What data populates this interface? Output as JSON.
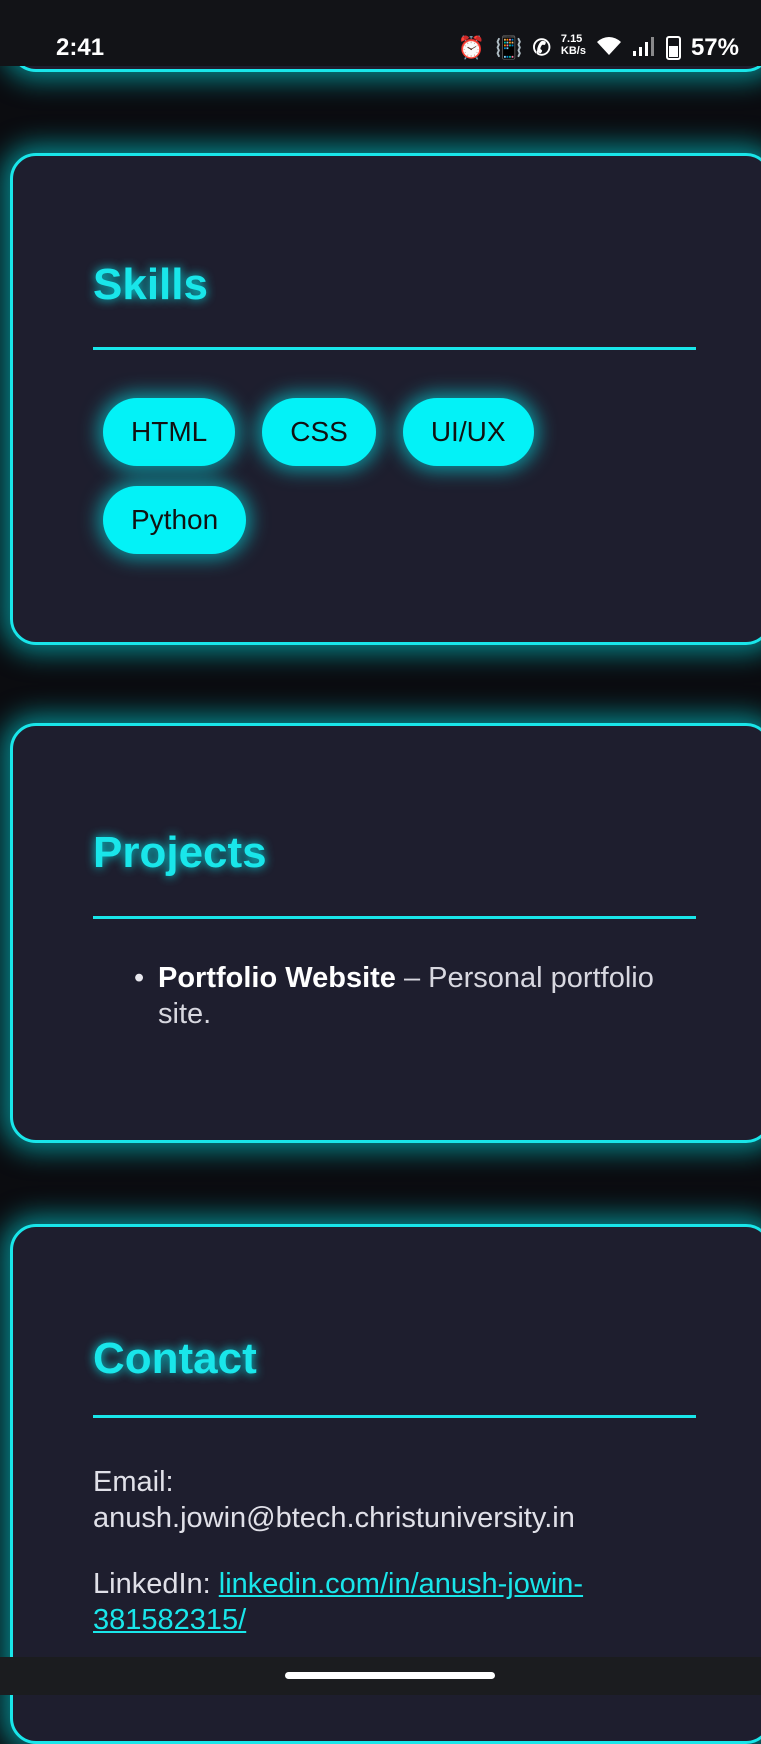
{
  "status_bar": {
    "time": "2:41",
    "speed_value": "7.15",
    "speed_unit": "KB/s",
    "battery": "57%",
    "icons": [
      "alarm-icon",
      "vibrate-icon",
      "call-icon",
      "wifi-icon",
      "signal-icon",
      "battery-icon"
    ]
  },
  "skills": {
    "title": "Skills",
    "items": [
      "HTML",
      "CSS",
      "UI/UX",
      "Python"
    ]
  },
  "projects": {
    "title": "Projects",
    "items": [
      {
        "name": "Portfolio Website",
        "description": " – Personal portfolio site."
      }
    ]
  },
  "contact": {
    "title": "Contact",
    "email_label": "Email:",
    "email": "anush.jowin@btech.christuniversity.in",
    "linkedin_label": "LinkedIn: ",
    "linkedin": "linkedin.com/in/anush-jowin-381582315/"
  },
  "colors": {
    "accent": "#19e6ea",
    "pill_bg": "#03f2f7",
    "card_bg": "#1e1e2e",
    "page_bg": "#0b0c10"
  }
}
